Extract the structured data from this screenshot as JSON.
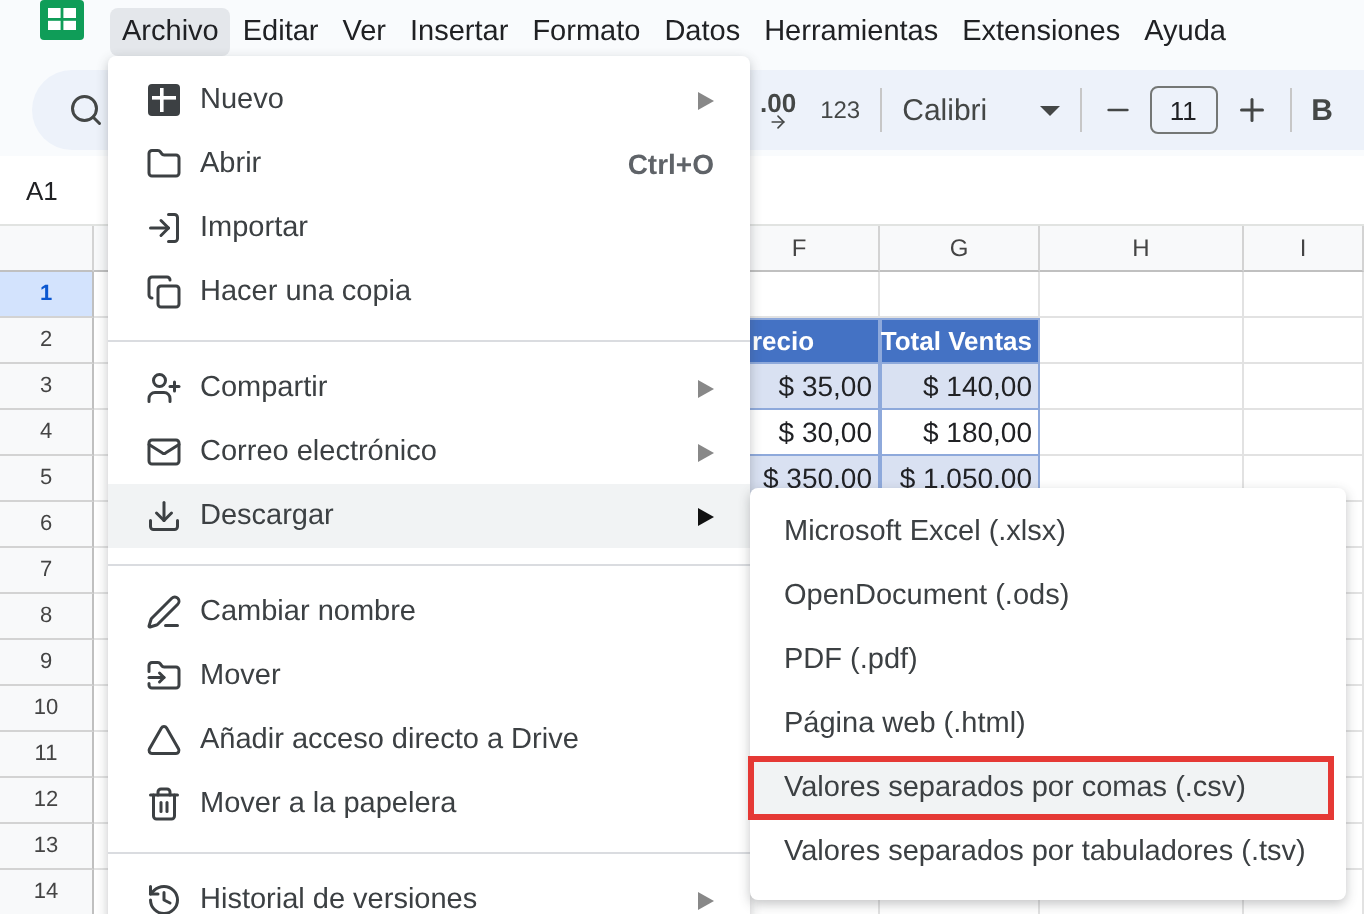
{
  "menu_bar": {
    "menus": [
      {
        "label": "Archivo",
        "selected": true
      },
      {
        "label": "Editar",
        "selected": false
      },
      {
        "label": "Ver",
        "selected": false
      },
      {
        "label": "Insertar",
        "selected": false
      },
      {
        "label": "Formato",
        "selected": false
      },
      {
        "label": "Datos",
        "selected": false
      },
      {
        "label": "Herramientas",
        "selected": false
      },
      {
        "label": "Extensiones",
        "selected": false
      },
      {
        "label": "Ayuda",
        "selected": false
      }
    ]
  },
  "toolbar": {
    "decimal_button": ".00",
    "number_format_button": "123",
    "font": "Calibri",
    "font_size": "11",
    "bold_button": "B"
  },
  "formula_bar": {
    "cell_reference": "A1"
  },
  "sheet": {
    "columns": [
      "F",
      "G",
      "H",
      "I"
    ],
    "row_numbers": [
      {
        "label": "1",
        "selected": true
      },
      {
        "label": "2",
        "selected": false
      },
      {
        "label": "3",
        "selected": false
      },
      {
        "label": "4",
        "selected": false
      },
      {
        "label": "5",
        "selected": false
      },
      {
        "label": "6",
        "selected": false
      },
      {
        "label": "7",
        "selected": false
      },
      {
        "label": "8",
        "selected": false
      },
      {
        "label": "9",
        "selected": false
      },
      {
        "label": "10",
        "selected": false
      },
      {
        "label": "11",
        "selected": false
      },
      {
        "label": "12",
        "selected": false
      },
      {
        "label": "13",
        "selected": false
      },
      {
        "label": "14",
        "selected": false
      }
    ],
    "table": {
      "header": [
        "recio",
        "Total Ventas"
      ],
      "rows": [
        {
          "cells": [
            "$ 35,00",
            "$ 140,00"
          ],
          "banded": true
        },
        {
          "cells": [
            "$ 30,00",
            "$ 180,00"
          ],
          "banded": false
        },
        {
          "cells": [
            "$ 350,00",
            "$ 1.050,00"
          ],
          "banded": true
        }
      ]
    }
  },
  "file_menu": {
    "items": [
      {
        "kind": "item",
        "label": "Nuevo",
        "submenu": true,
        "selected": false
      },
      {
        "kind": "item",
        "label": "Abrir",
        "shortcut": "Ctrl+O",
        "submenu": false,
        "selected": false
      },
      {
        "kind": "item",
        "label": "Importar",
        "submenu": false,
        "selected": false
      },
      {
        "kind": "item",
        "label": "Hacer una copia",
        "submenu": false,
        "selected": false
      },
      {
        "kind": "divider"
      },
      {
        "kind": "item",
        "label": "Compartir",
        "submenu": true,
        "selected": false
      },
      {
        "kind": "item",
        "label": "Correo electrónico",
        "submenu": true,
        "selected": false
      },
      {
        "kind": "item",
        "label": "Descargar",
        "submenu": true,
        "selected": true
      },
      {
        "kind": "divider"
      },
      {
        "kind": "item",
        "label": "Cambiar nombre",
        "submenu": false,
        "selected": false
      },
      {
        "kind": "item",
        "label": "Mover",
        "submenu": false,
        "selected": false
      },
      {
        "kind": "item",
        "label": "Añadir acceso directo a Drive",
        "submenu": false,
        "selected": false
      },
      {
        "kind": "item",
        "label": "Mover a la papelera",
        "submenu": false,
        "selected": false
      },
      {
        "kind": "divider"
      },
      {
        "kind": "item",
        "label": "Historial de versiones",
        "submenu": true,
        "selected": false
      }
    ]
  },
  "download_menu": {
    "items": [
      {
        "label": "Microsoft Excel (.xlsx)",
        "highlighted": false
      },
      {
        "label": "OpenDocument (.ods)",
        "highlighted": false
      },
      {
        "label": "PDF (.pdf)",
        "highlighted": false
      },
      {
        "label": "Página web (.html)",
        "highlighted": false
      },
      {
        "label": "Valores separados por comas (.csv)",
        "highlighted": true
      },
      {
        "label": "Valores separados por tabuladores (.tsv)",
        "highlighted": false
      }
    ]
  }
}
